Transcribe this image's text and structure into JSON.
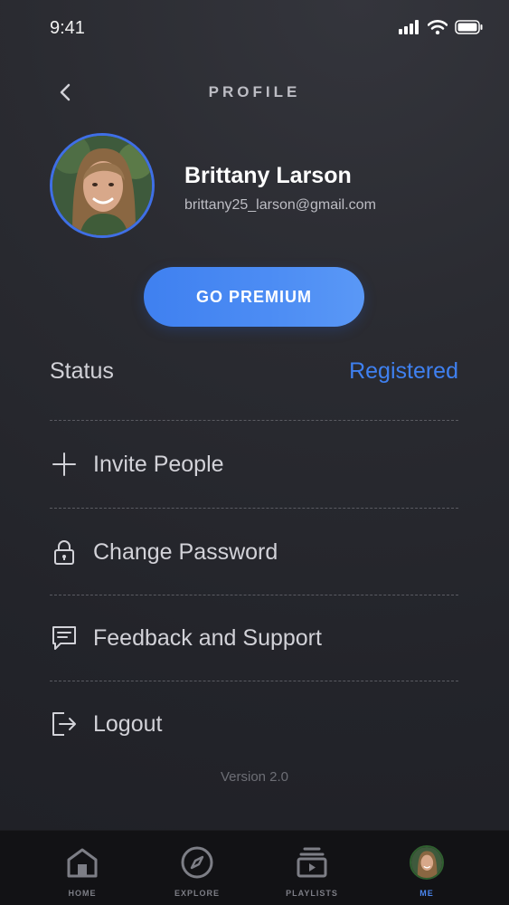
{
  "status_bar": {
    "time": "9:41"
  },
  "header": {
    "title": "PROFILE"
  },
  "profile": {
    "name": "Brittany Larson",
    "email": "brittany25_larson@gmail.com"
  },
  "premium_button": {
    "label": "GO PREMIUM"
  },
  "status": {
    "label": "Status",
    "value": "Registered"
  },
  "menu": {
    "items": [
      {
        "label": "Invite People",
        "icon": "plus-icon"
      },
      {
        "label": "Change Password",
        "icon": "lock-icon"
      },
      {
        "label": "Feedback and Support",
        "icon": "chat-icon"
      },
      {
        "label": "Logout",
        "icon": "logout-icon"
      }
    ]
  },
  "version": "Version 2.0",
  "tabbar": {
    "tabs": [
      {
        "label": "HOME",
        "icon": "home-icon"
      },
      {
        "label": "EXPLORE",
        "icon": "compass-icon"
      },
      {
        "label": "PLAYLISTS",
        "icon": "playlists-icon"
      },
      {
        "label": "ME",
        "icon": "avatar"
      }
    ],
    "active": "ME"
  },
  "colors": {
    "accent": "#3f80f0",
    "background": "#26272d",
    "tabbar": "#121215"
  }
}
